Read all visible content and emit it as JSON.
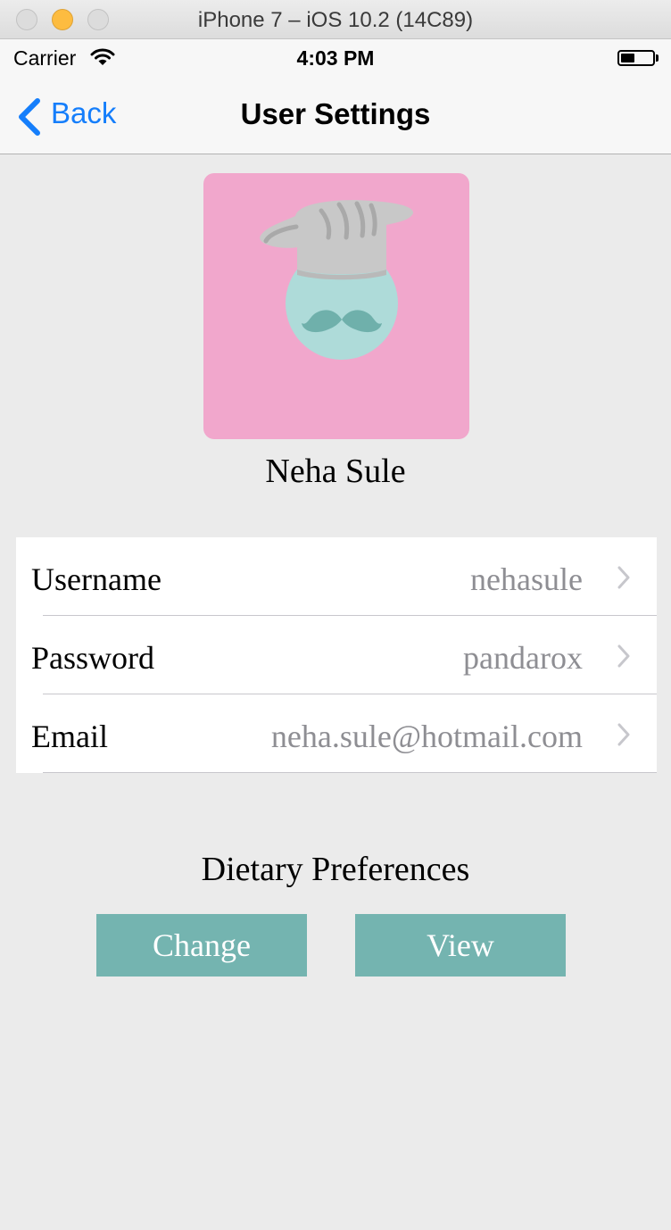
{
  "window": {
    "title": "iPhone 7 – iOS 10.2 (14C89)"
  },
  "status_bar": {
    "carrier": "Carrier",
    "time": "4:03 PM",
    "wifi_icon": "wifi-icon",
    "battery_icon": "battery-icon",
    "battery_level": 0.45
  },
  "nav": {
    "back_label": "Back",
    "title": "User Settings",
    "back_color": "#157efb"
  },
  "profile": {
    "name": "Neha Sule",
    "avatar_bg": "#f1a7cc",
    "avatar_icon": "chef-avatar-icon"
  },
  "settings_rows": [
    {
      "label": "Username",
      "value": "nehasule"
    },
    {
      "label": "Password",
      "value": "pandarox"
    },
    {
      "label": "Email",
      "value": "neha.sule@hotmail.com"
    }
  ],
  "dietary": {
    "title": "Dietary Preferences",
    "change_label": "Change",
    "view_label": "View",
    "button_color": "#74b4b0"
  }
}
